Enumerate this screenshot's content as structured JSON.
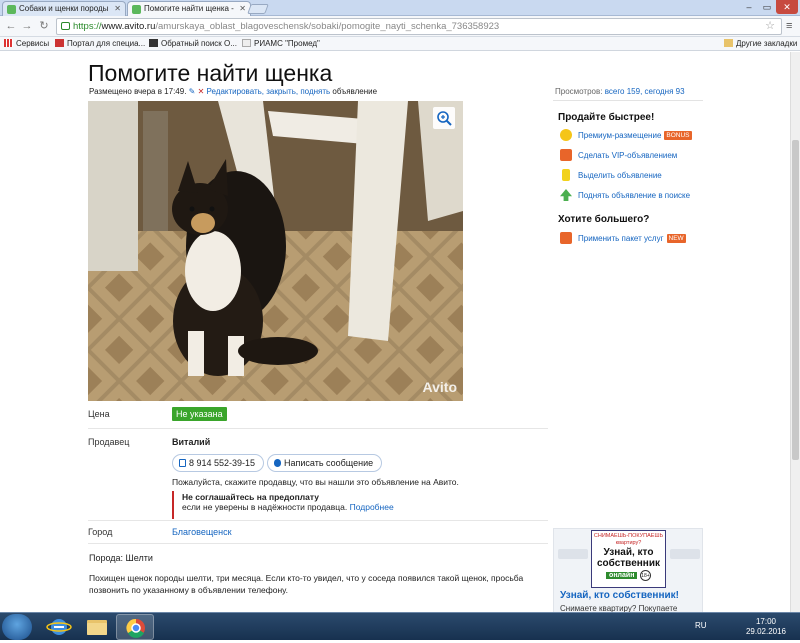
{
  "browser": {
    "tabs": [
      {
        "title": "Собаки и щенки породы"
      },
      {
        "title": "Помогите найти щенка -"
      }
    ],
    "url": {
      "scheme": "https://",
      "host": "www.avito.ru",
      "path": "/amurskaya_oblast_blagoveschensk/sobaki/pomogite_nayti_schenka_736358923"
    },
    "bookmarks": [
      {
        "label": "Сервисы"
      },
      {
        "label": "Портал для специа..."
      },
      {
        "label": "Обратный поиск О..."
      },
      {
        "label": "РИАМС \"Промед\""
      }
    ],
    "other_bookmarks": "Другие закладки"
  },
  "listing": {
    "title": "Помогите найти щенка",
    "posted": "Размещено вчера в 17:49.",
    "edit_links": "Редактировать, закрыть, поднять",
    "edit_suffix": "объявление",
    "views_label": "Просмотров:",
    "views_value": "всего 159, сегодня 93",
    "watermark": "Avito",
    "price_label": "Цена",
    "price_value": "Не указана",
    "seller_label": "Продавец",
    "seller_name": "Виталий",
    "phone": "8 914 552-39-15",
    "message_button": "Написать сообщение",
    "hint": "Пожалуйста, скажите продавцу, что вы нашли это объявление на Авито.",
    "warning_title": "Не соглашайтесь на предоплату",
    "warning_text": "если не уверены в надёжности продавца.",
    "warning_link": "Подробнее",
    "city_label": "Город",
    "city_value": "Благовещенск",
    "breed": "Порода: Шелти",
    "description": "Похищен щенок породы шелти, три месяца. Если кто-то увидел, что у соседа появился такой щенок, просьба позвонить по указанному в объявлении телефону."
  },
  "sidebar": {
    "sell_faster_heading": "Продайте быстрее!",
    "items": [
      {
        "label": "Премиум-размещение",
        "badge": "BONUS"
      },
      {
        "label": "Сделать VIP-объявлением"
      },
      {
        "label": "Выделить объявление"
      },
      {
        "label": "Поднять объявление в поиске"
      }
    ],
    "want_more_heading": "Хотите большего?",
    "package": {
      "label": "Применить пакет услуг",
      "badge": "NEW"
    }
  },
  "ad": {
    "card_small": "СНИМАЕШЬ-ПОКУПАЕШЬ квартиру?",
    "card_big": "Узнай, кто собственник",
    "card_online": "онлайн",
    "card_age": "18+",
    "title": "Узнай, кто собственник!",
    "text": "Снимаете квартиру? Покупаете квартиру? Узнайте, кто владелец"
  },
  "taskbar": {
    "lang": "RU",
    "time": "17:00",
    "date": "29.02.2016"
  },
  "colors": {
    "link": "#1565c0",
    "price_badge": "#3aa52b",
    "warning_border": "#c62828",
    "bonus_badge": "#e8652a",
    "new_badge": "#e8652a"
  }
}
